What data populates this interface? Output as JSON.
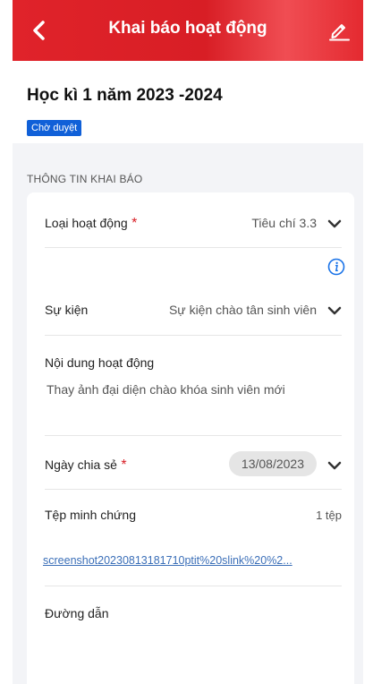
{
  "header": {
    "title": "Khai báo hoạt động"
  },
  "semester": {
    "title": "Học kì 1 năm 2023 -2024",
    "status": "Chờ duyệt"
  },
  "section": {
    "label": "THÔNG TIN KHAI BÁO"
  },
  "form": {
    "activity_type": {
      "label": "Loại hoạt động",
      "required": "*",
      "value": "Tiêu chí 3.3"
    },
    "event": {
      "label": "Sự kiện",
      "value": "Sự kiện chào tân sinh viên"
    },
    "content": {
      "label": "Nội dung hoạt động",
      "value": "Thay ảnh đại diện chào khóa sinh viên mới"
    },
    "share_date": {
      "label": "Ngày chia sẻ",
      "required": "*",
      "value": "13/08/2023"
    },
    "evidence": {
      "label": "Tệp minh chứng",
      "count": "1 tệp",
      "file_link": "screenshot20230813181710ptit%20slink%20%2..."
    },
    "url": {
      "label": "Đường dẫn"
    }
  },
  "colors": {
    "brand": "#e0232a",
    "badge": "#1060d8",
    "link": "#3b6fb8",
    "info": "#1a73e8",
    "annotation": "#e0232a"
  },
  "icons": {
    "back": "chevron-left-icon",
    "edit": "pencil-icon",
    "info": "info-circle-icon",
    "dropdown": "chevron-down-icon"
  }
}
